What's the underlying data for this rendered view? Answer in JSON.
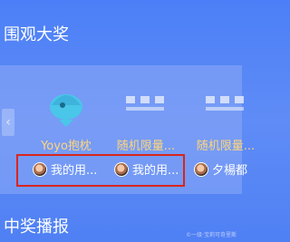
{
  "sections": {
    "lottery_title": "围观大奖",
    "broadcast_title": "中奖播报"
  },
  "prizes": [
    {
      "name": "Yoyo抱枕",
      "icon": "gift-plush-icon"
    },
    {
      "name": "随机限量...",
      "icon": "placeholder-image-icon"
    },
    {
      "name": "随机限量...",
      "icon": "placeholder-image-icon"
    }
  ],
  "winners": [
    {
      "name": "我的用..."
    },
    {
      "name": "我的用..."
    },
    {
      "name": "夕楊都"
    }
  ],
  "nav": {
    "prev_arrow": "‹"
  },
  "colors": {
    "accent": "#ffd67a",
    "highlight": "#d9251c",
    "background": "#5f8cf6"
  },
  "watermark": "©一级·宝莉可奇里斯"
}
